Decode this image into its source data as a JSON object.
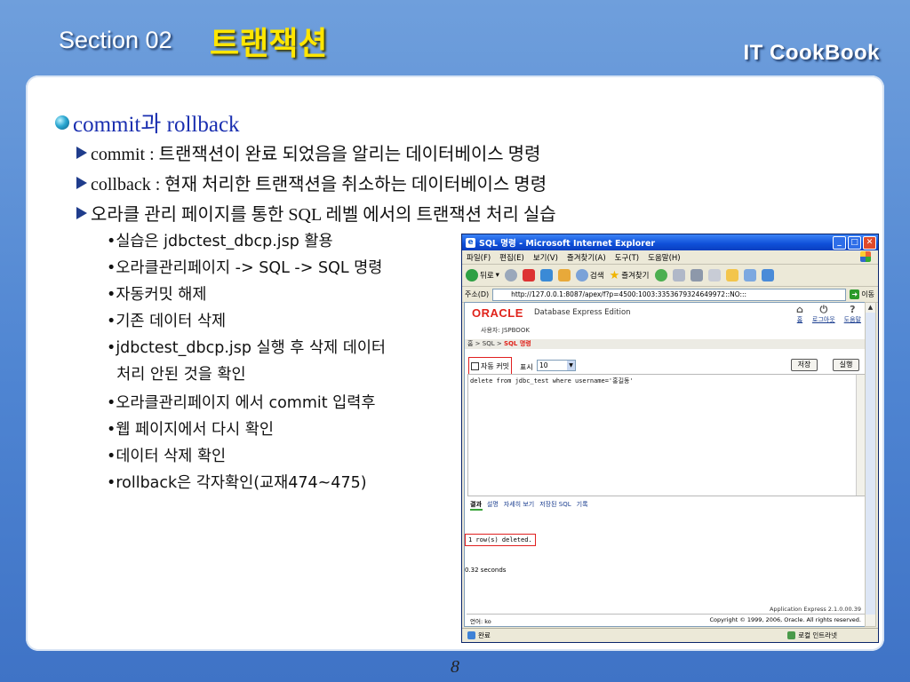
{
  "header": {
    "section": "Section 02",
    "title": "트랜잭션",
    "brand": "IT  CookBook"
  },
  "page_number": "8",
  "content": {
    "heading": "commit과 rollback",
    "level2": [
      "commit : 트랜잭션이 완료 되었음을 알리는 데이터베이스 명령",
      "collback : 현재 처리한 트랜잭션을 취소하는 데이터베이스 명령",
      "오라클 관리 페이지를 통한 SQL 레벨 에서의 트랜잭션 처리 실습"
    ],
    "level3": [
      "•실습은 jdbctest_dbcp.jsp 활용",
      "•오라클관리페이지 -> SQL -> SQL 명령",
      "•자동커밋 해제",
      "•기존 데이터 삭제",
      "•jdbctest_dbcp.jsp 실행 후 삭제 데이터",
      "  처리 안된 것을 확인",
      "•오라클관리페이지 에서 commit 입력후",
      "•웹 페이지에서 다시 확인",
      "•데이터 삭제 확인",
      "•rollback은 각자확인(교재474~475)"
    ]
  },
  "browser": {
    "title": "SQL 명령 - Microsoft Internet Explorer",
    "menu": [
      "파일(F)",
      "편집(E)",
      "보기(V)",
      "즐겨찾기(A)",
      "도구(T)",
      "도움말(H)"
    ],
    "toolbar": {
      "back": "뒤로",
      "search": "검색",
      "favorites": "즐겨찾기"
    },
    "address_label": "주소(D)",
    "url": "http://127.0.0.1:8087/apex/f?p=4500:1003:3353679324649972::NO:::",
    "go_label": "이동",
    "status_left": "완료",
    "status_right": "로컬 인트라넷",
    "app": {
      "oracle": "ORACLE",
      "product": "Database Express Edition",
      "icons": [
        {
          "glyph": "⌂",
          "label": "홈"
        },
        {
          "glyph": "⏻",
          "label": "로그아웃"
        },
        {
          "glyph": "?",
          "label": "도움말"
        }
      ],
      "user": "사용자: JSPBOOK",
      "breadcrumb_prefix": "홈 > SQL > ",
      "breadcrumb_current": "SQL 명령",
      "autocommit_label": "자동 커밋",
      "display_label": "표시",
      "display_value": "10",
      "save_label": "저장",
      "run_label": "실행",
      "sql_text": "delete from jdbc_test where username='홍길동'",
      "result_tabs": [
        "결과",
        "설명",
        "자세히 보기",
        "저장된 SQL",
        "기록"
      ],
      "result_text": "1 row(s) deleted.",
      "elapsed": "0.32 seconds",
      "version": "Application Express 2.1.0.00.39",
      "language": "언어: ko",
      "copyright": "Copyright © 1999, 2006, Oracle. All rights reserved."
    }
  }
}
